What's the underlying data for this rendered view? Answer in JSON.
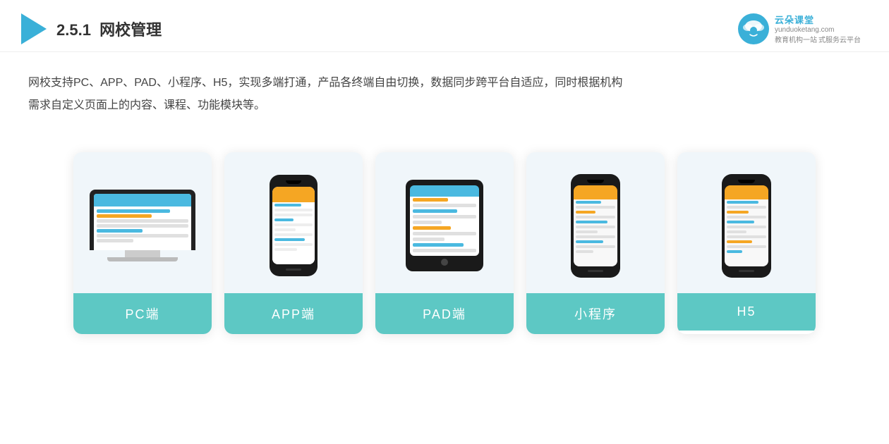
{
  "header": {
    "section_number": "2.5.1",
    "title_plain": "",
    "title_bold": "网校管理",
    "brand": {
      "name": "云朵课堂",
      "name_en": "yunduoketang.com",
      "slogan": "教育机构一站",
      "slogan2": "式服务云平台"
    }
  },
  "description": {
    "line1": "网校支持PC、APP、PAD、小程序、H5，实现多端打通，产品各终端自由切换，数据同步跨平台自适应，同时根据机构",
    "line2": "需求自定义页面上的内容、课程、功能模块等。"
  },
  "cards": [
    {
      "id": "pc",
      "label": "PC端"
    },
    {
      "id": "app",
      "label": "APP端"
    },
    {
      "id": "pad",
      "label": "PAD端"
    },
    {
      "id": "mini",
      "label": "小程序"
    },
    {
      "id": "h5",
      "label": "H5"
    }
  ]
}
